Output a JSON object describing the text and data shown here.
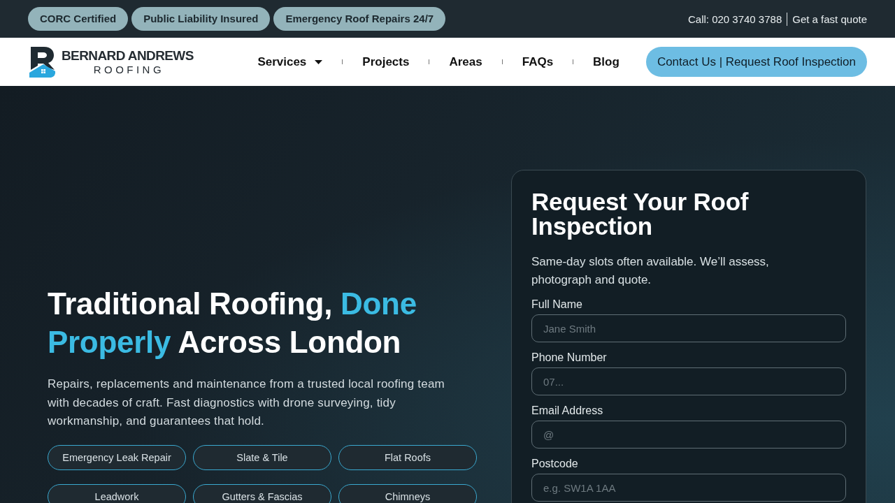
{
  "top_bar": {
    "badges": [
      "CORC Certified",
      "Public Liability Insured",
      "Emergency Roof Repairs 24/7"
    ],
    "phone_link": "Call: 020 3740 3788",
    "quote_link": "Get a fast quote"
  },
  "header": {
    "logo": {
      "name": "BERNARD ANDREWS",
      "tagline": "ROOFING"
    },
    "nav": [
      {
        "label": "Services",
        "dropdown": true
      },
      {
        "label": "Projects",
        "dropdown": false
      },
      {
        "label": "Areas",
        "dropdown": false
      },
      {
        "label": "FAQs",
        "dropdown": false
      },
      {
        "label": "Blog",
        "dropdown": false
      }
    ],
    "cta": "Contact Us | Request Roof Inspection"
  },
  "hero": {
    "heading": [
      {
        "text": "Traditional Roofing, ",
        "accent": false
      },
      {
        "text": "Done Properly",
        "accent": true
      },
      {
        "text": " Across London",
        "accent": false
      }
    ],
    "intro": "Repairs, replacements and maintenance from a trusted local roofing team with decades of craft. Fast diagnostics with drone surveying, tidy workmanship, and guarantees that hold.",
    "services": [
      "Emergency Leak Repair",
      "Slate & Tile",
      "Flat Roofs",
      "Leadwork",
      "Gutters & Fascias",
      "Chimneys"
    ]
  },
  "form": {
    "title": "Request Your Roof Inspection",
    "subtitle": "Same-day slots often available. We’ll assess, photograph and quote.",
    "fields": [
      {
        "label": "Full Name",
        "placeholder": "Jane Smith"
      },
      {
        "label": "Phone Number",
        "placeholder": "07..."
      },
      {
        "label": "Email Address",
        "placeholder": "@"
      },
      {
        "label": "Postcode",
        "placeholder": "e.g. SW1A 1AA"
      }
    ]
  }
}
